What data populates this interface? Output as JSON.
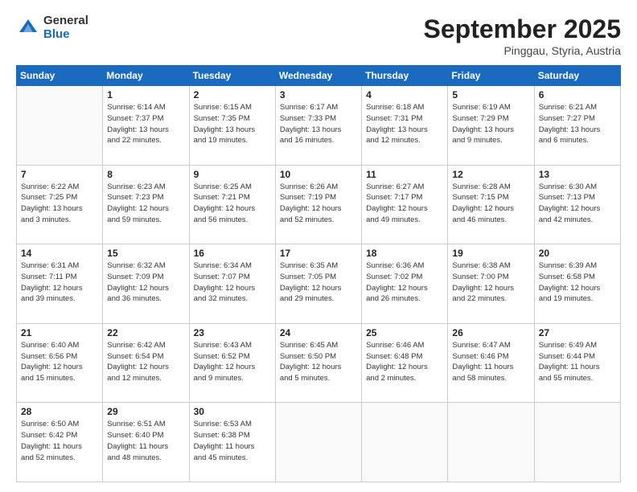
{
  "logo": {
    "general": "General",
    "blue": "Blue"
  },
  "title": {
    "month": "September 2025",
    "location": "Pinggau, Styria, Austria"
  },
  "weekdays": [
    "Sunday",
    "Monday",
    "Tuesday",
    "Wednesday",
    "Thursday",
    "Friday",
    "Saturday"
  ],
  "weeks": [
    [
      {
        "day": "",
        "info": ""
      },
      {
        "day": "1",
        "info": "Sunrise: 6:14 AM\nSunset: 7:37 PM\nDaylight: 13 hours\nand 22 minutes."
      },
      {
        "day": "2",
        "info": "Sunrise: 6:15 AM\nSunset: 7:35 PM\nDaylight: 13 hours\nand 19 minutes."
      },
      {
        "day": "3",
        "info": "Sunrise: 6:17 AM\nSunset: 7:33 PM\nDaylight: 13 hours\nand 16 minutes."
      },
      {
        "day": "4",
        "info": "Sunrise: 6:18 AM\nSunset: 7:31 PM\nDaylight: 13 hours\nand 12 minutes."
      },
      {
        "day": "5",
        "info": "Sunrise: 6:19 AM\nSunset: 7:29 PM\nDaylight: 13 hours\nand 9 minutes."
      },
      {
        "day": "6",
        "info": "Sunrise: 6:21 AM\nSunset: 7:27 PM\nDaylight: 13 hours\nand 6 minutes."
      }
    ],
    [
      {
        "day": "7",
        "info": "Sunrise: 6:22 AM\nSunset: 7:25 PM\nDaylight: 13 hours\nand 3 minutes."
      },
      {
        "day": "8",
        "info": "Sunrise: 6:23 AM\nSunset: 7:23 PM\nDaylight: 12 hours\nand 59 minutes."
      },
      {
        "day": "9",
        "info": "Sunrise: 6:25 AM\nSunset: 7:21 PM\nDaylight: 12 hours\nand 56 minutes."
      },
      {
        "day": "10",
        "info": "Sunrise: 6:26 AM\nSunset: 7:19 PM\nDaylight: 12 hours\nand 52 minutes."
      },
      {
        "day": "11",
        "info": "Sunrise: 6:27 AM\nSunset: 7:17 PM\nDaylight: 12 hours\nand 49 minutes."
      },
      {
        "day": "12",
        "info": "Sunrise: 6:28 AM\nSunset: 7:15 PM\nDaylight: 12 hours\nand 46 minutes."
      },
      {
        "day": "13",
        "info": "Sunrise: 6:30 AM\nSunset: 7:13 PM\nDaylight: 12 hours\nand 42 minutes."
      }
    ],
    [
      {
        "day": "14",
        "info": "Sunrise: 6:31 AM\nSunset: 7:11 PM\nDaylight: 12 hours\nand 39 minutes."
      },
      {
        "day": "15",
        "info": "Sunrise: 6:32 AM\nSunset: 7:09 PM\nDaylight: 12 hours\nand 36 minutes."
      },
      {
        "day": "16",
        "info": "Sunrise: 6:34 AM\nSunset: 7:07 PM\nDaylight: 12 hours\nand 32 minutes."
      },
      {
        "day": "17",
        "info": "Sunrise: 6:35 AM\nSunset: 7:05 PM\nDaylight: 12 hours\nand 29 minutes."
      },
      {
        "day": "18",
        "info": "Sunrise: 6:36 AM\nSunset: 7:02 PM\nDaylight: 12 hours\nand 26 minutes."
      },
      {
        "day": "19",
        "info": "Sunrise: 6:38 AM\nSunset: 7:00 PM\nDaylight: 12 hours\nand 22 minutes."
      },
      {
        "day": "20",
        "info": "Sunrise: 6:39 AM\nSunset: 6:58 PM\nDaylight: 12 hours\nand 19 minutes."
      }
    ],
    [
      {
        "day": "21",
        "info": "Sunrise: 6:40 AM\nSunset: 6:56 PM\nDaylight: 12 hours\nand 15 minutes."
      },
      {
        "day": "22",
        "info": "Sunrise: 6:42 AM\nSunset: 6:54 PM\nDaylight: 12 hours\nand 12 minutes."
      },
      {
        "day": "23",
        "info": "Sunrise: 6:43 AM\nSunset: 6:52 PM\nDaylight: 12 hours\nand 9 minutes."
      },
      {
        "day": "24",
        "info": "Sunrise: 6:45 AM\nSunset: 6:50 PM\nDaylight: 12 hours\nand 5 minutes."
      },
      {
        "day": "25",
        "info": "Sunrise: 6:46 AM\nSunset: 6:48 PM\nDaylight: 12 hours\nand 2 minutes."
      },
      {
        "day": "26",
        "info": "Sunrise: 6:47 AM\nSunset: 6:46 PM\nDaylight: 11 hours\nand 58 minutes."
      },
      {
        "day": "27",
        "info": "Sunrise: 6:49 AM\nSunset: 6:44 PM\nDaylight: 11 hours\nand 55 minutes."
      }
    ],
    [
      {
        "day": "28",
        "info": "Sunrise: 6:50 AM\nSunset: 6:42 PM\nDaylight: 11 hours\nand 52 minutes."
      },
      {
        "day": "29",
        "info": "Sunrise: 6:51 AM\nSunset: 6:40 PM\nDaylight: 11 hours\nand 48 minutes."
      },
      {
        "day": "30",
        "info": "Sunrise: 6:53 AM\nSunset: 6:38 PM\nDaylight: 11 hours\nand 45 minutes."
      },
      {
        "day": "",
        "info": ""
      },
      {
        "day": "",
        "info": ""
      },
      {
        "day": "",
        "info": ""
      },
      {
        "day": "",
        "info": ""
      }
    ]
  ]
}
